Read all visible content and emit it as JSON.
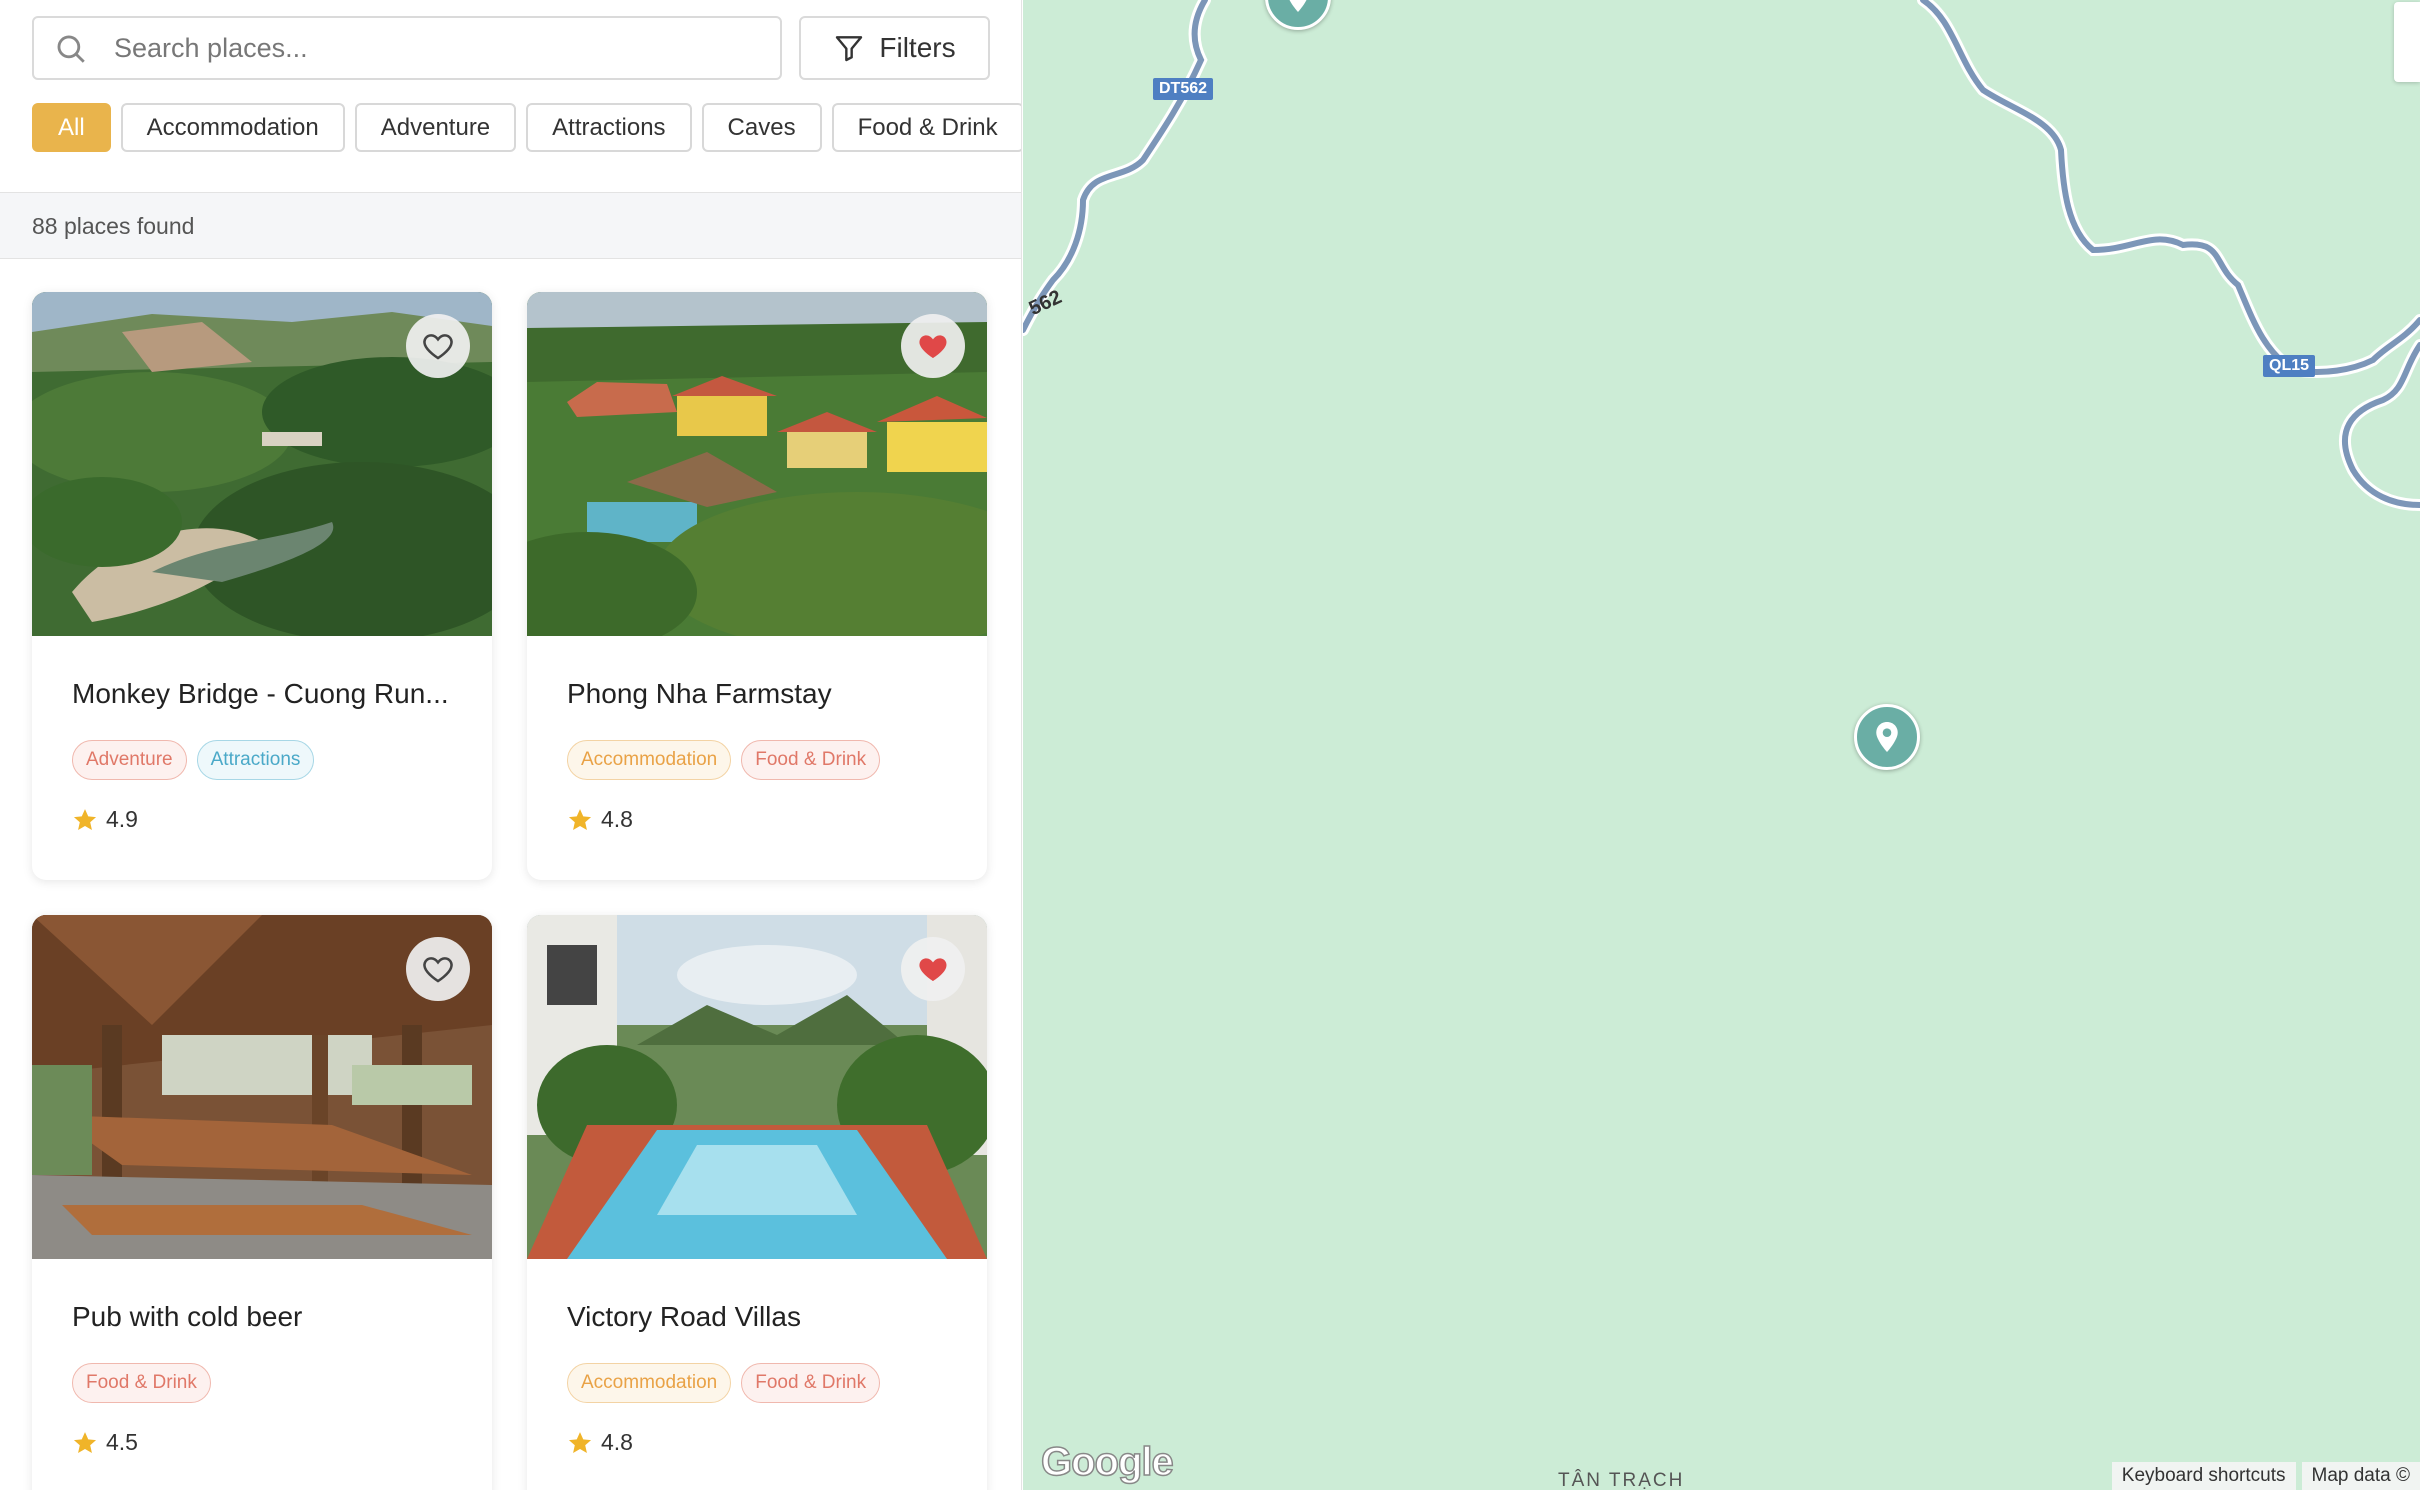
{
  "search": {
    "placeholder": "Search places..."
  },
  "filters_label": "Filters",
  "categories": [
    {
      "label": "All",
      "active": true
    },
    {
      "label": "Accommodation",
      "active": false
    },
    {
      "label": "Adventure",
      "active": false
    },
    {
      "label": "Attractions",
      "active": false
    },
    {
      "label": "Caves",
      "active": false
    },
    {
      "label": "Food & Drink",
      "active": false
    }
  ],
  "results": {
    "count_text": "88 places found"
  },
  "cards": [
    {
      "title": "Monkey Bridge - Cuong Run...",
      "favorited": false,
      "rating": "4.9",
      "tags": [
        {
          "label": "Adventure",
          "type": "adventure"
        },
        {
          "label": "Attractions",
          "type": "attractions"
        }
      ]
    },
    {
      "title": "Phong Nha Farmstay",
      "favorited": true,
      "rating": "4.8",
      "tags": [
        {
          "label": "Accommodation",
          "type": "accommodation"
        },
        {
          "label": "Food & Drink",
          "type": "food"
        }
      ]
    },
    {
      "title": "Pub with cold beer",
      "favorited": false,
      "rating": "4.5",
      "tags": [
        {
          "label": "Food & Drink",
          "type": "food"
        }
      ]
    },
    {
      "title": "Victory Road Villas",
      "favorited": true,
      "rating": "4.8",
      "tags": [
        {
          "label": "Accommodation",
          "type": "accommodation"
        },
        {
          "label": "Food & Drink",
          "type": "food"
        }
      ]
    }
  ],
  "map": {
    "road_labels": {
      "dt562": "DT562",
      "dt562_partial": "562",
      "ql15": "QL15"
    },
    "place_label": "TÂN TRẠCH",
    "logo": "Google",
    "attribution": {
      "shortcuts": "Keyboard shortcuts",
      "map_data": "Map data ©"
    }
  },
  "colors": {
    "accent": "#e9b44c",
    "map_bg": "#ccecd6",
    "pin": "#6aaea5",
    "heart": "#e04848"
  }
}
